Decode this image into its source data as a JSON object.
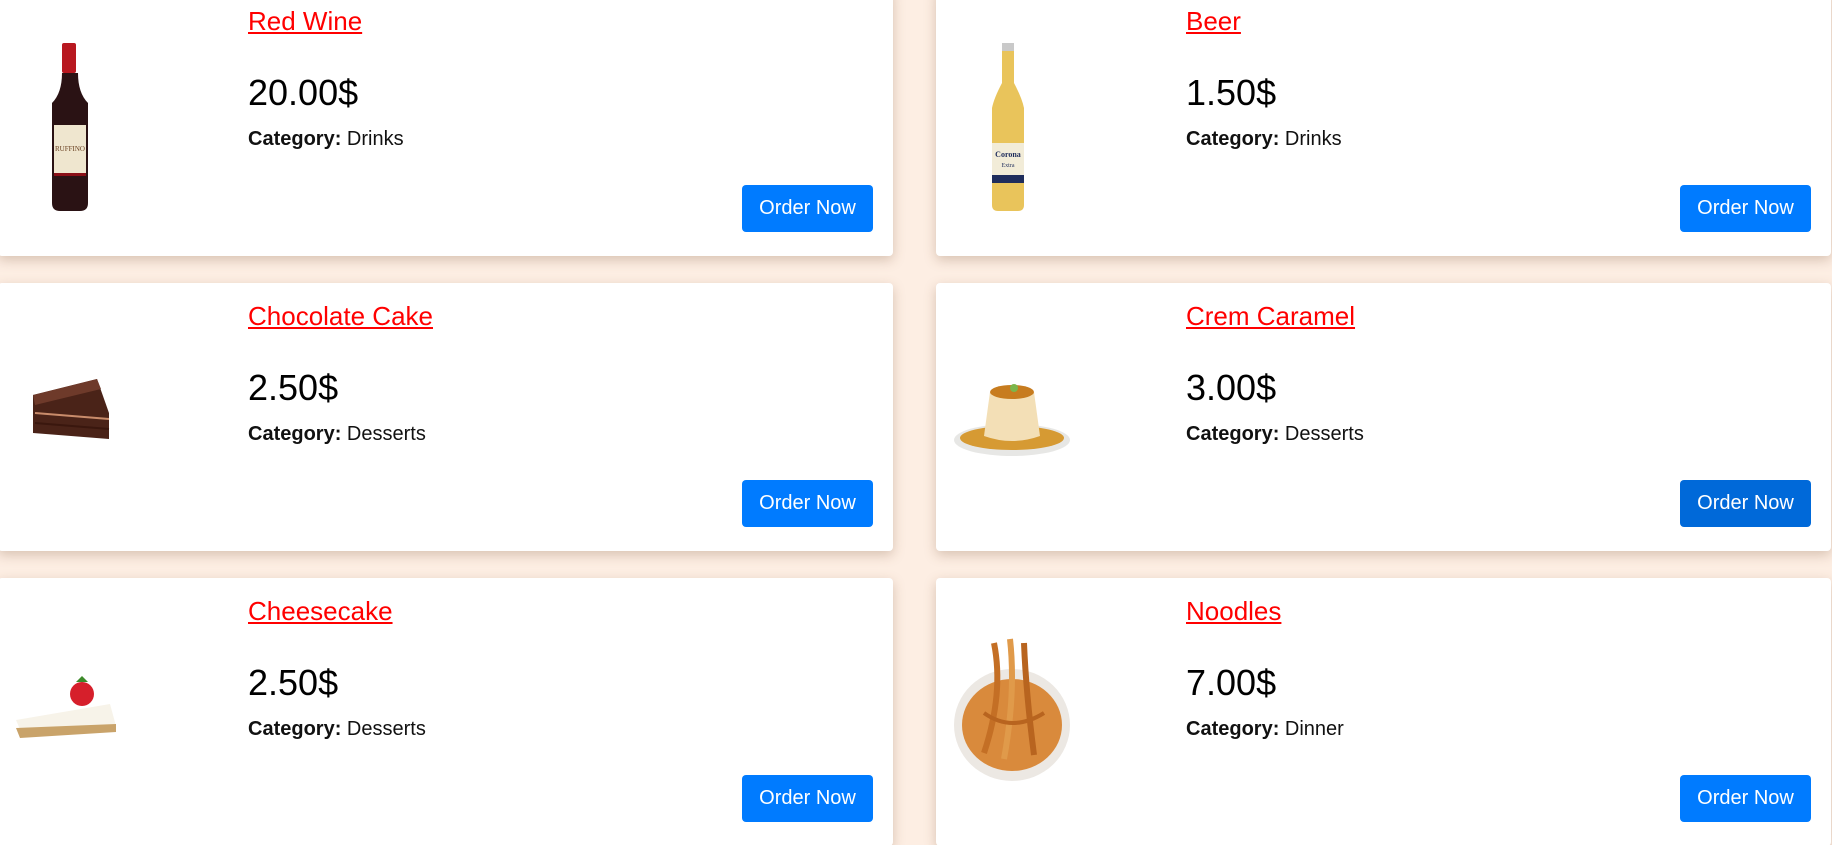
{
  "products": [
    {
      "name": "Red Wine",
      "price": "20.00$",
      "category_label": "Category:",
      "category": "Drinks",
      "button": "Order Now",
      "image": "red-wine-bottle"
    },
    {
      "name": "Beer",
      "price": "1.50$",
      "category_label": "Category:",
      "category": "Drinks",
      "button": "Order Now",
      "image": "beer-bottle"
    },
    {
      "name": "Chocolate Cake",
      "price": "2.50$",
      "category_label": "Category:",
      "category": "Desserts",
      "button": "Order Now",
      "image": "chocolate-cake-slice"
    },
    {
      "name": "Crem Caramel",
      "price": "3.00$",
      "category_label": "Category:",
      "category": "Desserts",
      "button": "Order Now",
      "image": "creme-caramel"
    },
    {
      "name": "Cheesecake",
      "price": "2.50$",
      "category_label": "Category:",
      "category": "Desserts",
      "button": "Order Now",
      "image": "cheesecake-slice"
    },
    {
      "name": "Noodles",
      "price": "7.00$",
      "category_label": "Category:",
      "category": "Dinner",
      "button": "Order Now",
      "image": "noodles-bowl"
    }
  ],
  "colors": {
    "background": "#fdeee3",
    "title": "#ff0000",
    "button": "#007bff",
    "button_hover": "#0069d9"
  }
}
